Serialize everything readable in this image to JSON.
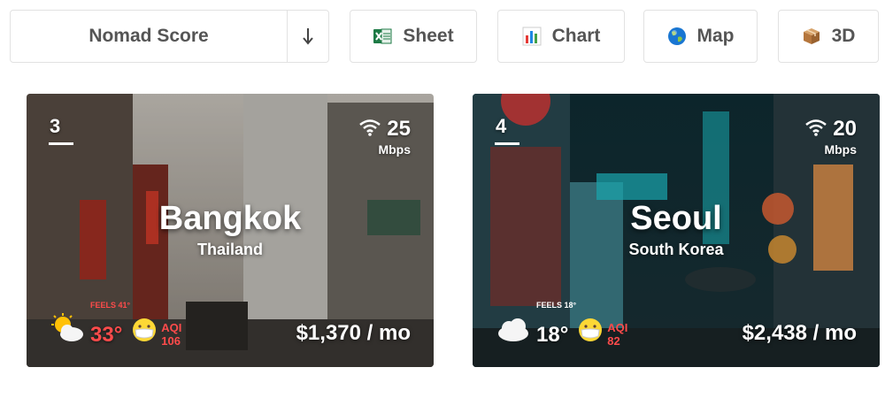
{
  "toolbar": {
    "sort_label": "Nomad Score",
    "sheet_label": "Sheet",
    "chart_label": "Chart",
    "map_label": "Map",
    "threed_label": "3D"
  },
  "cities": [
    {
      "rank": "3",
      "city": "Bangkok",
      "country": "Thailand",
      "internet_speed": "25",
      "internet_unit": "Mbps",
      "feels_like": "FEELS 41°",
      "temperature": "33°",
      "aqi_label": "AQI",
      "aqi_value": "106",
      "cost": "$1,370 / mo",
      "weather_icon": "sun-behind-cloud-icon"
    },
    {
      "rank": "4",
      "city": "Seoul",
      "country": "South Korea",
      "internet_speed": "20",
      "internet_unit": "Mbps",
      "feels_like": "FEELS 18°",
      "temperature": "18°",
      "aqi_label": "AQI",
      "aqi_value": "82",
      "cost": "$2,438 / mo",
      "weather_icon": "cloud-icon"
    }
  ],
  "colors": {
    "accent_red": "#ff4b4b",
    "button_text": "#555555",
    "border": "#e2e2e2"
  }
}
